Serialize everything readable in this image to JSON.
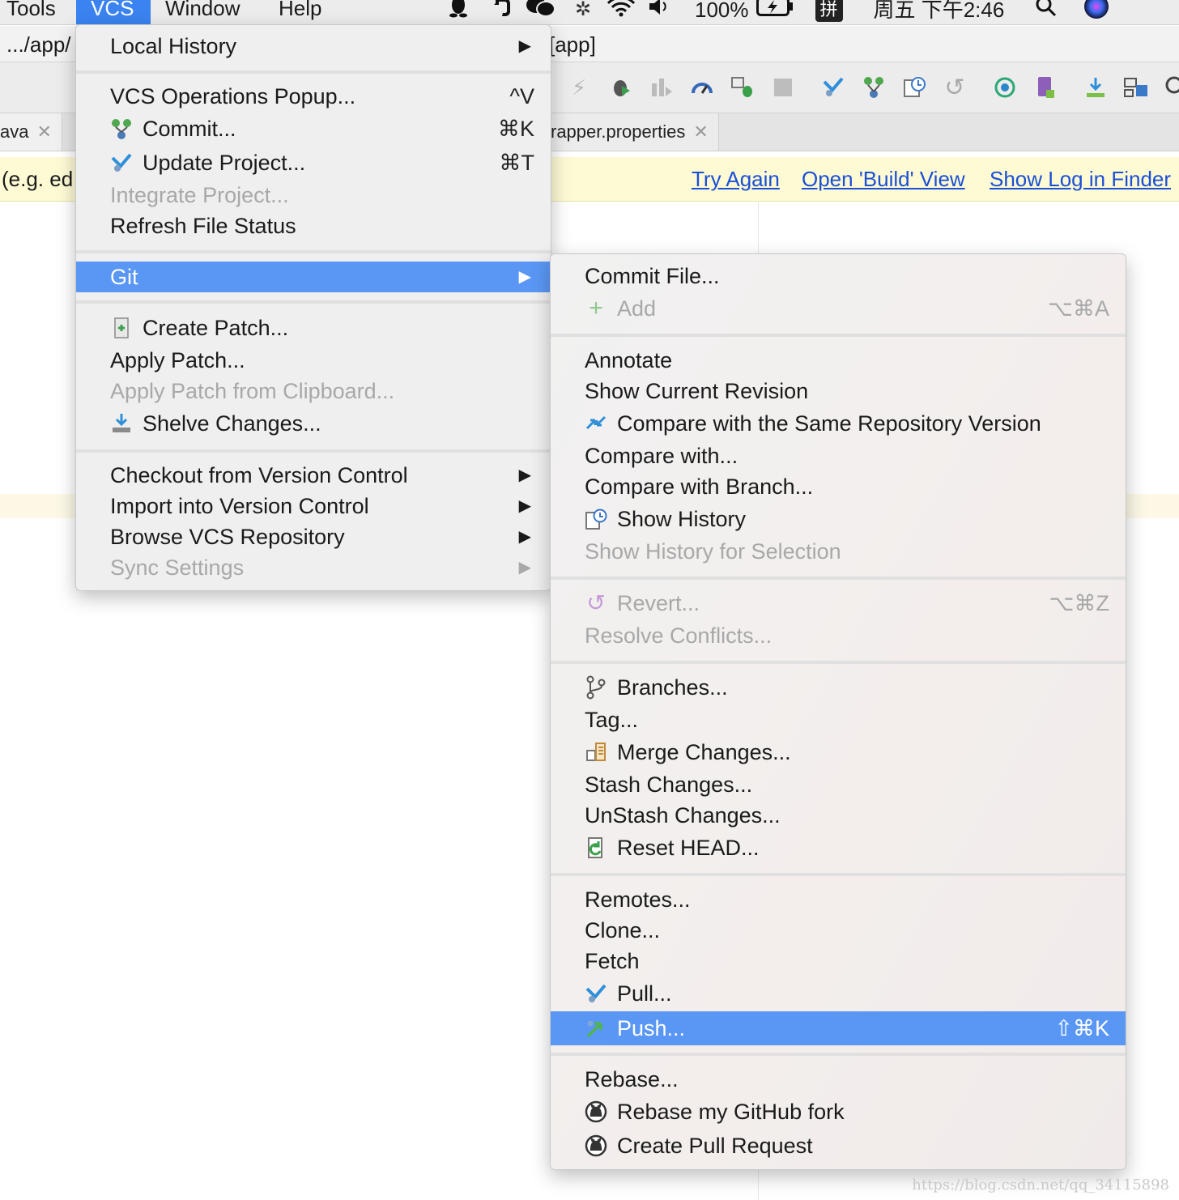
{
  "menubar": {
    "items": [
      "Tools",
      "VCS",
      "Window",
      "Help"
    ],
    "battery": "100%",
    "input_method": "拼",
    "clock": "周五 下午2:46"
  },
  "navbar": {
    "path_left": ".../app/",
    "path_right": "[app]"
  },
  "tabs": {
    "left": "ava",
    "right": "rapper.properties"
  },
  "notification": {
    "left_text": "(e.g. ed",
    "links": [
      "Try Again",
      "Open 'Build' View",
      "Show Log in Finder"
    ]
  },
  "vcs_menu": {
    "local_history": "Local History",
    "ops_popup": "VCS Operations Popup...",
    "ops_popup_sc": "^V",
    "commit": "Commit...",
    "commit_sc": "⌘K",
    "update": "Update Project...",
    "update_sc": "⌘T",
    "integrate": "Integrate Project...",
    "refresh": "Refresh File Status",
    "git": "Git",
    "create_patch": "Create Patch...",
    "apply_patch": "Apply Patch...",
    "apply_clip": "Apply Patch from Clipboard...",
    "shelve": "Shelve Changes...",
    "checkout": "Checkout from Version Control",
    "import": "Import into Version Control",
    "browse": "Browse VCS Repository",
    "sync": "Sync Settings"
  },
  "git_menu": {
    "commit_file": "Commit File...",
    "add": "Add",
    "add_sc": "⌥⌘A",
    "annotate": "Annotate",
    "show_current": "Show Current Revision",
    "compare_same": "Compare with the Same Repository Version",
    "compare_with": "Compare with...",
    "compare_branch": "Compare with Branch...",
    "show_history": "Show History",
    "show_history_sel": "Show History for Selection",
    "revert": "Revert...",
    "revert_sc": "⌥⌘Z",
    "resolve": "Resolve Conflicts...",
    "branches": "Branches...",
    "tag": "Tag...",
    "merge": "Merge Changes...",
    "stash": "Stash Changes...",
    "unstash": "UnStash Changes...",
    "reset": "Reset HEAD...",
    "remotes": "Remotes...",
    "clone": "Clone...",
    "fetch": "Fetch",
    "pull": "Pull...",
    "push": "Push...",
    "push_sc": "⇧⌘K",
    "rebase": "Rebase...",
    "rebase_fork": "Rebase my GitHub fork",
    "pull_request": "Create Pull Request"
  },
  "watermark": "https://blog.csdn.net/qq_34115898",
  "colors": {
    "highlight": "#5a97f5",
    "menubar_active": "#3a83f0",
    "link": "#1a4fd6",
    "notification_bg": "#fdfad4"
  }
}
